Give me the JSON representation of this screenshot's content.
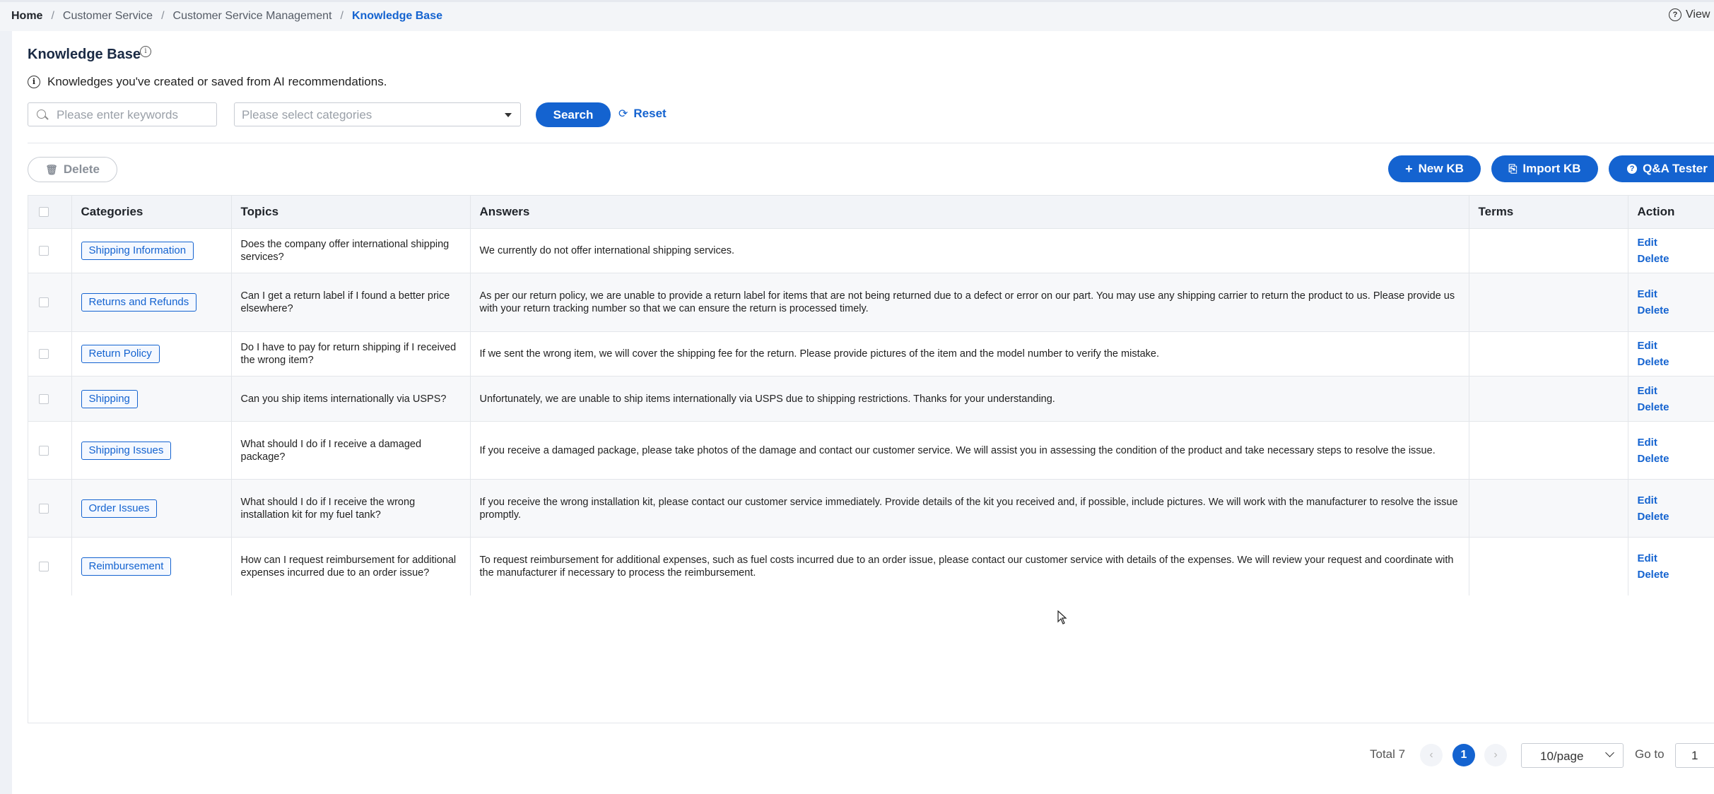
{
  "breadcrumb": {
    "home": "Home",
    "items": [
      "Customer Service",
      "Customer Service Management"
    ],
    "current": "Knowledge Base",
    "separator": "/"
  },
  "header": {
    "view_label": "View I"
  },
  "page": {
    "title": "Knowledge Base",
    "hint": "Knowledges you've created or saved from AI recommendations."
  },
  "filters": {
    "keyword_placeholder": "Please enter keywords",
    "category_placeholder": "Please select categories",
    "search_label": "Search",
    "reset_label": "Reset"
  },
  "toolbar": {
    "delete_label": "Delete",
    "new_kb_label": "New KB",
    "import_kb_label": "Import KB",
    "qa_tester_label": "Q&A Tester"
  },
  "table": {
    "columns": {
      "categories": "Categories",
      "topics": "Topics",
      "answers": "Answers",
      "terms": "Terms",
      "action": "Action"
    },
    "edit_label": "Edit",
    "delete_label": "Delete",
    "rows": [
      {
        "category": "Shipping Information",
        "topic": "Does the company offer international shipping services?",
        "answer": "We currently do not offer international shipping services.",
        "terms": ""
      },
      {
        "category": "Returns and Refunds",
        "topic": "Can I get a return label if I found a better price elsewhere?",
        "answer": "As per our return policy, we are unable to provide a return label for items that are not being returned due to a defect or error on our part. You may use any shipping carrier to return the product to us. Please provide us with your return tracking number so that we can ensure the return is processed timely.",
        "terms": ""
      },
      {
        "category": "Return Policy",
        "topic": "Do I have to pay for return shipping if I received the wrong item?",
        "answer": "If we sent the wrong item, we will cover the shipping fee for the return. Please provide pictures of the item and the model number to verify the mistake.",
        "terms": ""
      },
      {
        "category": "Shipping",
        "topic": "Can you ship items internationally via USPS?",
        "answer": "Unfortunately, we are unable to ship items internationally via USPS due to shipping restrictions. Thanks for your understanding.",
        "terms": ""
      },
      {
        "category": "Shipping Issues",
        "topic": "What should I do if I receive a damaged package?",
        "answer": "If you receive a damaged package, please take photos of the damage and contact our customer service. We will assist you in assessing the condition of the product and take necessary steps to resolve the issue.",
        "terms": ""
      },
      {
        "category": "Order Issues",
        "topic": "What should I do if I receive the wrong installation kit for my fuel tank?",
        "answer": "If you receive the wrong installation kit, please contact our customer service immediately. Provide details of the kit you received and, if possible, include pictures. We will work with the manufacturer to resolve the issue promptly.",
        "terms": ""
      },
      {
        "category": "Reimbursement",
        "topic": "How can I request reimbursement for additional expenses incurred due to an order issue?",
        "answer": "To request reimbursement for additional expenses, such as fuel costs incurred due to an order issue, please contact our customer service with details of the expenses. We will review your request and coordinate with the manufacturer if necessary to process the reimbursement.",
        "terms": ""
      }
    ]
  },
  "pagination": {
    "total_label": "Total 7",
    "prev_symbol": "‹",
    "next_symbol": "›",
    "current_page": "1",
    "page_size": "10/page",
    "goto_label": "Go to",
    "goto_value": "1"
  },
  "colors": {
    "accent": "#1463d0",
    "background": "#eef1f6"
  }
}
